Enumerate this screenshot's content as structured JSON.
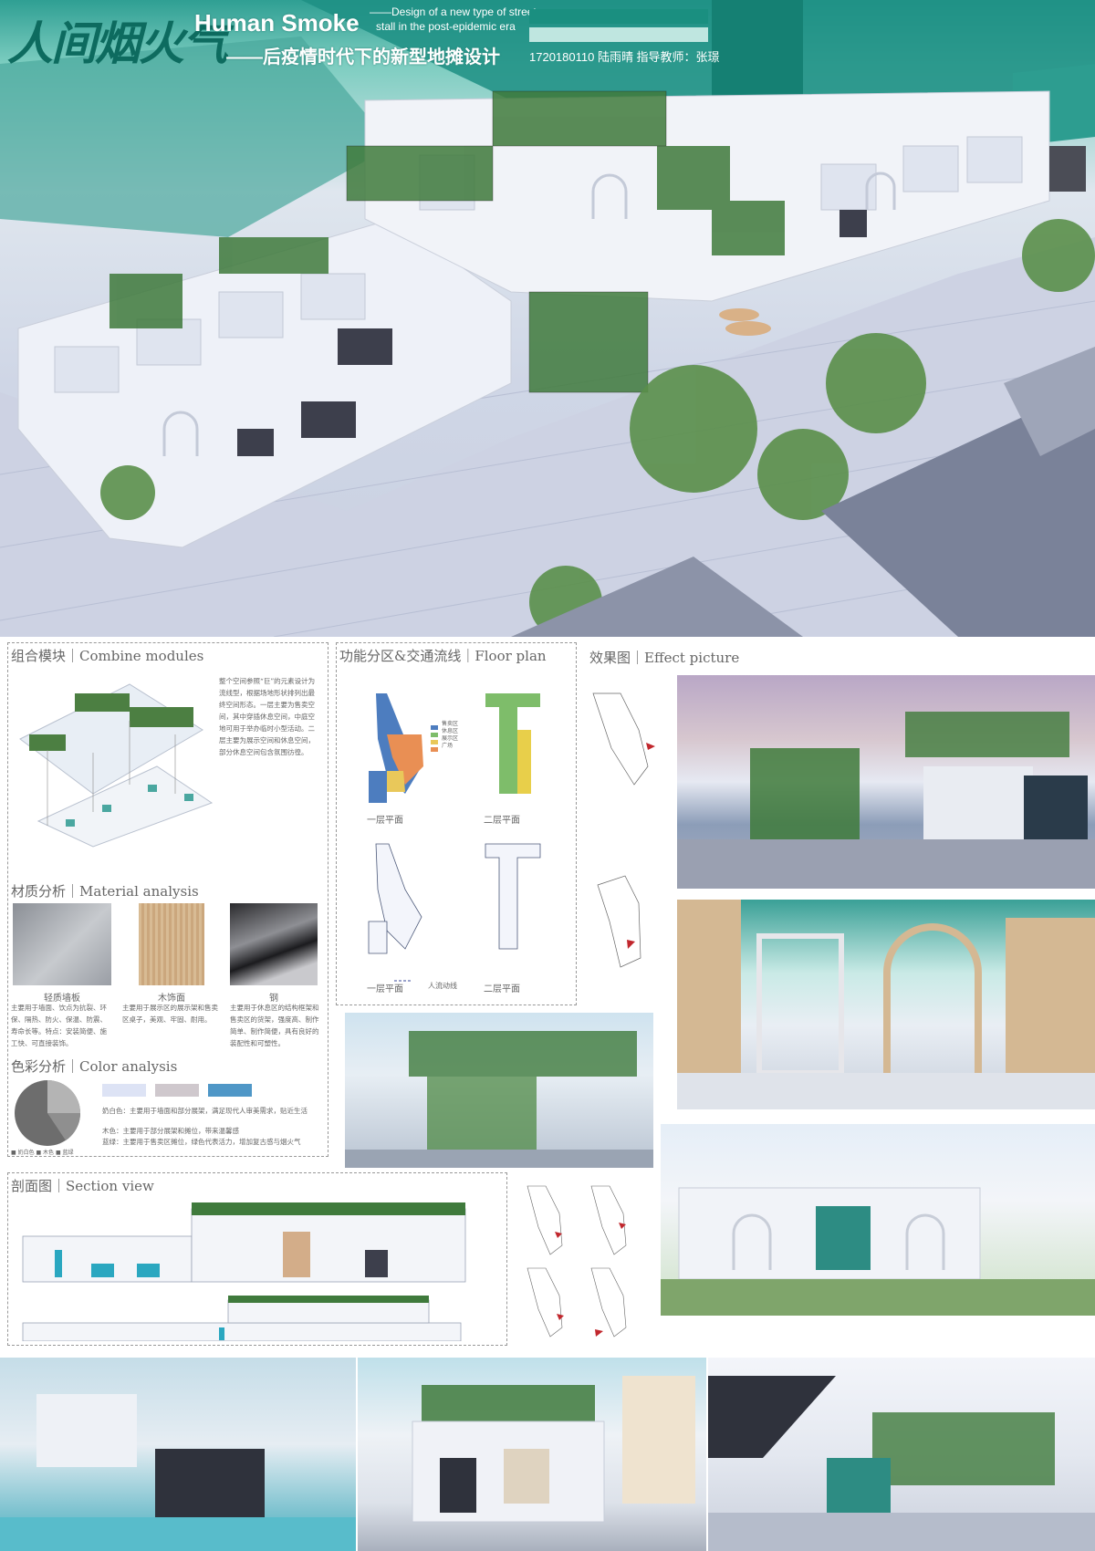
{
  "header": {
    "title_cn": "人间烟火气",
    "title_en": "Human Smoke",
    "subtitle": "——后疫情时代下的新型地摊设计",
    "design_line_1": "——Design of a new type of street",
    "design_line_2": "stall in the post-epidemic era",
    "student": "1720180110 陆雨晴  指导教师：张璟",
    "accent_color": "#1a8f80"
  },
  "sections": {
    "combine": {
      "title": "组合模块｜Combine modules",
      "text": "整个空间参照“巨”的元素设计为流线型，根据场地形状排列出最终空间形态。一层主要为售卖空间，其中穿插休息空间，中庭空地可用于举办临时小型活动。二层主要为展示空间和休息空间，部分休息空间包含氛围彷徨。"
    },
    "material": {
      "title": "材质分析｜Material analysis",
      "items": [
        {
          "name": "轻质墙板",
          "desc": "主要用于墙面、饮点为抗裂、环保、隔热、防火、保温、防震、寿命长等。特点：安装简便、施工快、可直接装饰。"
        },
        {
          "name": "木饰面",
          "desc": "主要用于展示区的展示架和售卖区桌子，美观、牢固、耐用。"
        },
        {
          "name": "钢",
          "desc": "主要用于休息区的结构框架和售卖区的货架，强度高、制作简单、制作简便，具有良好的装配性和可塑性。"
        }
      ]
    },
    "color": {
      "title": "色彩分析｜Color analysis",
      "swatches": [
        "#dde3f5",
        "#cfc8cd",
        "#4f97c7"
      ],
      "lines": [
        "奶白色：主要用于墙面和部分展架，满足现代人审美需求，贴近生活",
        "木色：主要用于部分展架和摊位，带来温馨感",
        "蓝绿：主要用于售卖区摊位，绿色代表活力，增加复古感与烟火气"
      ],
      "legend": "■ 奶白色  ■ 木色  ■ 蓝绿"
    },
    "floor": {
      "title": "功能分区&交通流线｜Floor plan",
      "labels": [
        "一层平面",
        "二层平面",
        "一层平面",
        "二层平面"
      ],
      "legend_flow": "人流动线",
      "legend_items": [
        "售卖区",
        "休息区",
        "展示区",
        "广场"
      ]
    },
    "effect": {
      "title": "效果图｜Effect picture"
    },
    "section": {
      "title": "剖面图｜Section view"
    }
  }
}
